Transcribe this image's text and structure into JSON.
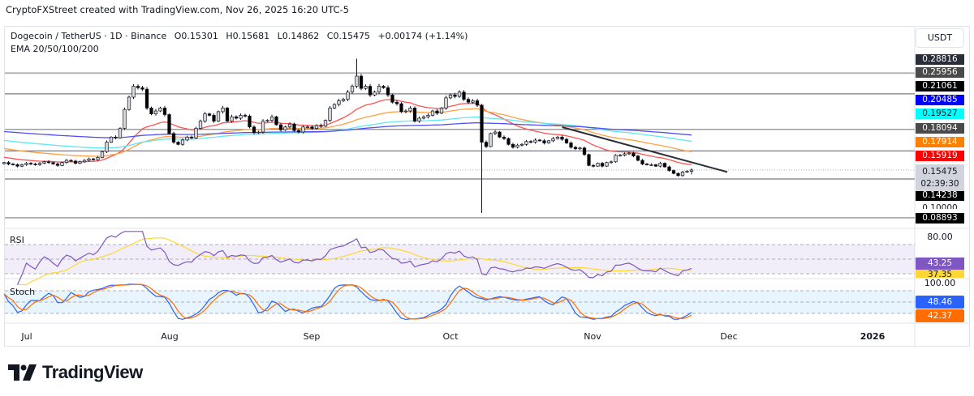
{
  "credit": "CryptoFXStreet created with TradingView.com, Nov 26, 2025 16:20 UTC-5",
  "legend": {
    "symbol": "Dogecoin / TetherUS · 1D · Binance",
    "open": "O0.15301",
    "high": "H0.15681",
    "low": "L0.14862",
    "close": "C0.15475",
    "change": "+0.00174 (+1.14%)",
    "indicator": "EMA 20/50/100/200"
  },
  "currency_button": "USDT",
  "price_labels": [
    {
      "text": "0.28816",
      "bg": "#2a2e39",
      "fg": "#ffffff"
    },
    {
      "text": "0.25956",
      "bg": "#4a4a4a",
      "fg": "#ffffff"
    },
    {
      "text": "0.21061",
      "bg": "#000000",
      "fg": "#ffffff"
    },
    {
      "text": "0.20485",
      "bg": "#0000ff",
      "fg": "#ffffff"
    },
    {
      "text": "0.19527",
      "bg": "#00ffff",
      "fg": "#131722"
    },
    {
      "text": "0.18094",
      "bg": "#4a4a4a",
      "fg": "#ffffff"
    },
    {
      "text": "0.17914",
      "bg": "#ff8000",
      "fg": "#ffffff"
    },
    {
      "text": "0.15919",
      "bg": "#ff0000",
      "fg": "#ffffff"
    },
    {
      "text": "0.14238",
      "bg": "#000000",
      "fg": "#ffffff"
    },
    {
      "text": "0.10000",
      "bg": "#ffffff",
      "fg": "#131722"
    },
    {
      "text": "0.08893",
      "bg": "#000000",
      "fg": "#ffffff"
    }
  ],
  "last_price": {
    "price": "0.15475",
    "countdown": "02:39:30"
  },
  "horizontal_levels": [
    0.28816,
    0.25956,
    0.21061,
    0.18094,
    0.14238,
    0.08893
  ],
  "rsi": {
    "label": "RSI",
    "axis_label": "80.00",
    "value": "43.25",
    "ma_value": "37.35",
    "color": "#7e57c2",
    "ma_color": "#fdd835"
  },
  "stoch": {
    "label": "Stoch",
    "axis_label": "100.00",
    "k_value": "48.46",
    "d_value": "42.37",
    "k_color": "#2962ff",
    "d_color": "#ff6d00"
  },
  "time_axis": [
    "Jul",
    "Aug",
    "Sep",
    "Oct",
    "Nov",
    "Dec",
    "2026"
  ],
  "logo": "TradingView",
  "chart_data": {
    "type": "candlestick",
    "symbol": "DOGE/USDT",
    "interval": "1D",
    "closes": [
      0.165,
      0.163,
      0.162,
      0.16,
      0.162,
      0.164,
      0.163,
      0.162,
      0.164,
      0.166,
      0.165,
      0.163,
      0.161,
      0.165,
      0.168,
      0.167,
      0.164,
      0.166,
      0.168,
      0.17,
      0.169,
      0.172,
      0.18,
      0.193,
      0.2,
      0.199,
      0.212,
      0.238,
      0.255,
      0.27,
      0.268,
      0.266,
      0.24,
      0.232,
      0.236,
      0.24,
      0.231,
      0.205,
      0.193,
      0.19,
      0.196,
      0.2,
      0.199,
      0.212,
      0.222,
      0.232,
      0.23,
      0.222,
      0.235,
      0.24,
      0.222,
      0.228,
      0.226,
      0.23,
      0.229,
      0.214,
      0.206,
      0.207,
      0.222,
      0.223,
      0.228,
      0.217,
      0.21,
      0.214,
      0.218,
      0.209,
      0.207,
      0.214,
      0.214,
      0.212,
      0.216,
      0.215,
      0.223,
      0.24,
      0.245,
      0.25,
      0.252,
      0.262,
      0.27,
      0.284,
      0.267,
      0.27,
      0.258,
      0.262,
      0.27,
      0.268,
      0.258,
      0.248,
      0.246,
      0.235,
      0.236,
      0.24,
      0.222,
      0.226,
      0.228,
      0.23,
      0.236,
      0.233,
      0.24,
      0.254,
      0.258,
      0.256,
      0.262,
      0.252,
      0.248,
      0.25,
      0.244,
      0.193,
      0.187,
      0.205,
      0.207,
      0.2,
      0.198,
      0.19,
      0.186,
      0.189,
      0.19,
      0.194,
      0.193,
      0.196,
      0.195,
      0.192,
      0.195,
      0.198,
      0.2,
      0.197,
      0.192,
      0.186,
      0.184,
      0.185,
      0.176,
      0.161,
      0.16,
      0.164,
      0.16,
      0.165,
      0.166,
      0.175,
      0.175,
      0.177,
      0.178,
      0.174,
      0.168,
      0.163,
      0.162,
      0.162,
      0.16,
      0.164,
      0.159,
      0.154,
      0.15,
      0.147,
      0.152,
      0.153,
      0.15475
    ],
    "last_open": 0.15301,
    "last_high": 0.15681,
    "last_low": 0.14862,
    "wick_extremes": [
      {
        "index": 79,
        "high": 0.308
      },
      {
        "index": 107,
        "low": 0.0955
      }
    ],
    "ema": [
      {
        "name": "EMA 20",
        "period": 20,
        "color": "#ff5252",
        "start": 0.173,
        "last": 0.15919
      },
      {
        "name": "EMA 50",
        "period": 50,
        "color": "#ffa040",
        "start": 0.185,
        "last": 0.17914
      },
      {
        "name": "EMA 100",
        "period": 100,
        "color": "#5ee8f0",
        "start": 0.196,
        "last": 0.19527
      },
      {
        "name": "EMA 200",
        "period": 200,
        "color": "#5050f0",
        "start": 0.208,
        "last": 0.20485
      }
    ],
    "trendline": {
      "start_index": 125,
      "start_price": 0.2137,
      "end_index": 162,
      "end_price": 0.152
    },
    "rsi_levels": [
      70,
      50,
      30
    ],
    "stoch_levels": [
      80,
      50,
      20
    ],
    "x_labels": [
      "Jul",
      "Aug",
      "Sep",
      "Oct",
      "Nov",
      "Dec",
      "2026"
    ]
  }
}
